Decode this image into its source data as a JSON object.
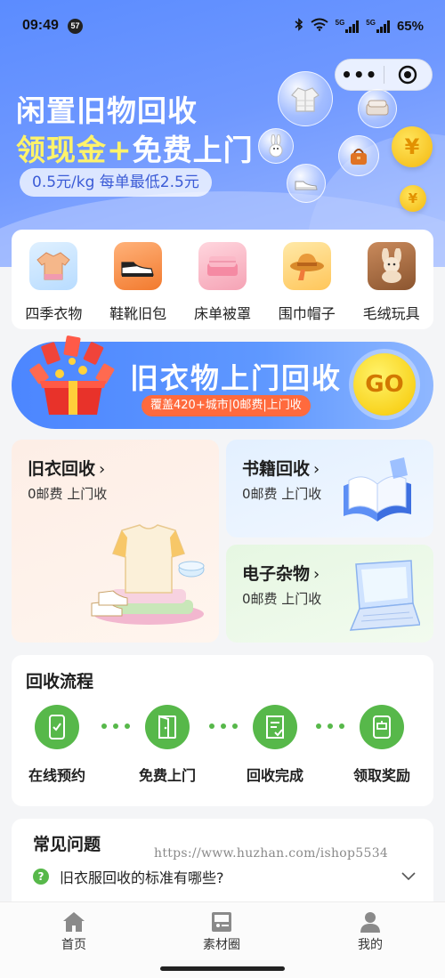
{
  "status": {
    "time": "09:49",
    "badge": "57",
    "net1": "5G",
    "net2": "5G",
    "battery": "65%"
  },
  "hero": {
    "line1": "闲置旧物回收",
    "line2_highlight": "领现金+",
    "line2_rest": "免费上门",
    "pill": "0.5元/kg 每单最低2.5元",
    "coin_symbol": "¥",
    "menu_dots": "•••"
  },
  "categories": [
    {
      "label": "四季衣物",
      "icon": "sweater-icon"
    },
    {
      "label": "鞋靴旧包",
      "icon": "sneaker-icon"
    },
    {
      "label": "床单被罩",
      "icon": "bedsheet-icon"
    },
    {
      "label": "围巾帽子",
      "icon": "hat-icon"
    },
    {
      "label": "毛绒玩具",
      "icon": "teddy-bear-icon"
    }
  ],
  "banner": {
    "title": "旧衣物上门回收",
    "subtitle": "覆盖420+城市|0邮费|上门收",
    "go": "GO"
  },
  "services": [
    {
      "name": "旧衣回收",
      "chevron": "›",
      "desc": "0邮费 上门收"
    },
    {
      "name": "书籍回收",
      "chevron": "›",
      "desc": "0邮费 上门收"
    },
    {
      "name": "电子杂物",
      "chevron": "›",
      "desc": "0邮费 上门收"
    }
  ],
  "process": {
    "title": "回收流程",
    "steps": [
      "在线预约",
      "免费上门",
      "回收完成",
      "领取奖励"
    ]
  },
  "faq": {
    "title": "常见问题",
    "question": "旧衣服回收的标准有哪些?",
    "qmark": "?"
  },
  "watermark": "https://www.huzhan.com/ishop5534",
  "tabs": [
    {
      "label": "首页"
    },
    {
      "label": "素材圈"
    },
    {
      "label": "我的"
    }
  ],
  "colors": {
    "primary": "#5b8cff",
    "green": "#57b84a",
    "accent_yellow": "#fff36a",
    "orange": "#ff6a3d"
  }
}
